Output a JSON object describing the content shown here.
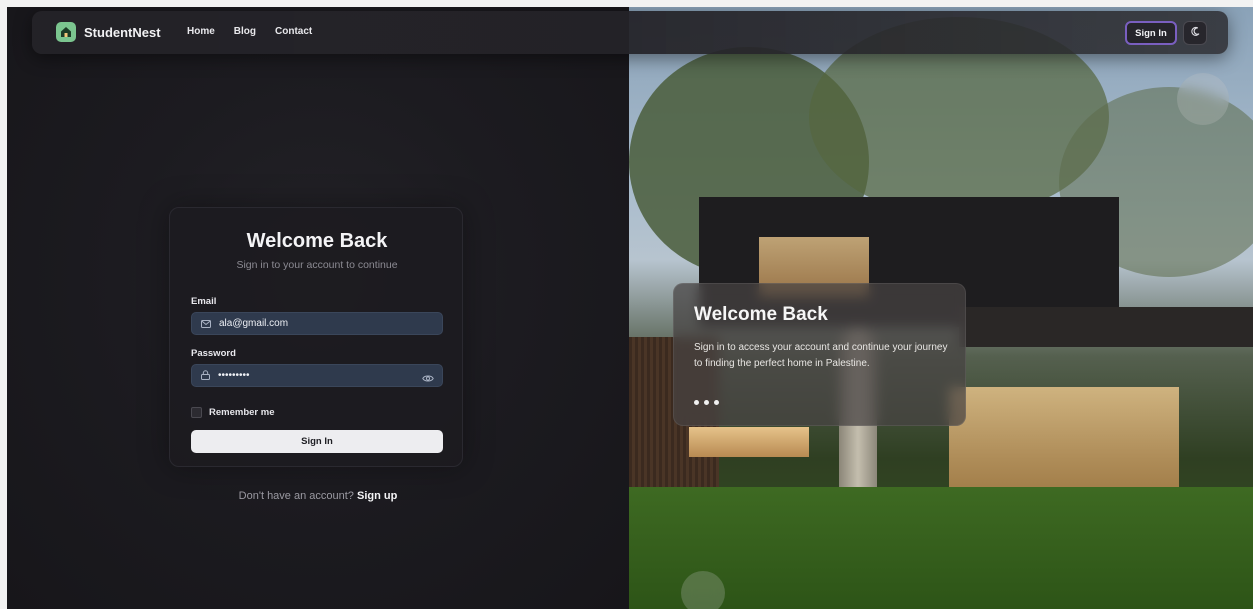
{
  "nav": {
    "brand": "StudentNest",
    "links": [
      "Home",
      "Blog",
      "Contact"
    ],
    "sign_in": "Sign In",
    "theme_icon": "moon-icon"
  },
  "form": {
    "title": "Welcome Back",
    "subtitle": "Sign in to your account to continue",
    "email_label": "Email",
    "email_value": "ala@gmail.com",
    "password_label": "Password",
    "password_value": "•••••••••",
    "remember_label": "Remember me",
    "submit_label": "Sign In",
    "signup_prompt": "Don't have an account?",
    "signup_link": "Sign up"
  },
  "hero": {
    "title": "Welcome Back",
    "text": "Sign in to access your account and continue your journey to finding the perfect home in Palestine."
  },
  "colors": {
    "accent": "#7a5fc0",
    "brand_logo": "#7bc58f",
    "input_bg": "#2f3a4d"
  }
}
